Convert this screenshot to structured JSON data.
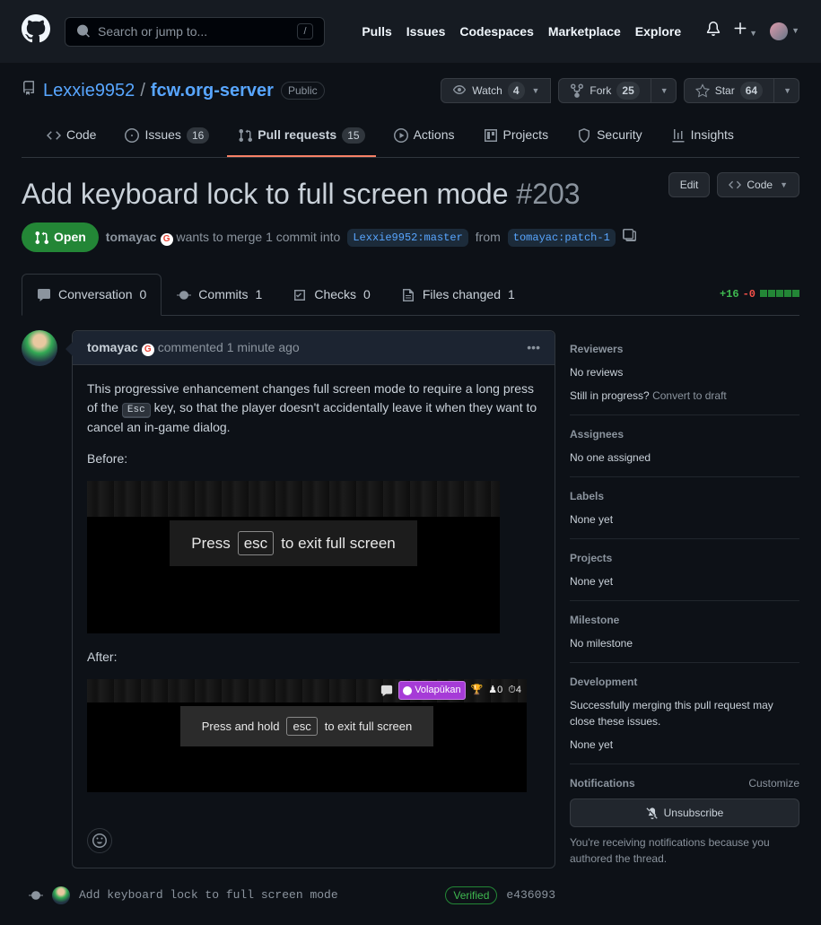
{
  "nav": {
    "search_placeholder": "Search or jump to...",
    "slash": "/",
    "pulls": "Pulls",
    "issues": "Issues",
    "codespaces": "Codespaces",
    "marketplace": "Marketplace",
    "explore": "Explore"
  },
  "repo": {
    "owner": "Lexxie9952",
    "name": "fcw.org-server",
    "sep": "/",
    "visibility": "Public",
    "watch": {
      "label": "Watch",
      "count": "4"
    },
    "fork": {
      "label": "Fork",
      "count": "25"
    },
    "star": {
      "label": "Star",
      "count": "64"
    },
    "tabs": {
      "code": "Code",
      "issues": {
        "label": "Issues",
        "count": "16"
      },
      "pulls": {
        "label": "Pull requests",
        "count": "15"
      },
      "actions": "Actions",
      "projects": "Projects",
      "security": "Security",
      "insights": "Insights"
    }
  },
  "pr": {
    "title": "Add keyboard lock to full screen mode",
    "number": "#203",
    "edit": "Edit",
    "code_btn": "Code",
    "state": "Open",
    "author": "tomayac",
    "merge_text_1": "wants to merge 1 commit into",
    "base": "Lexxie9952:master",
    "from": "from",
    "head": "tomayac:patch-1",
    "tabs": {
      "conversation": {
        "label": "Conversation",
        "count": "0"
      },
      "commits": {
        "label": "Commits",
        "count": "1"
      },
      "checks": {
        "label": "Checks",
        "count": "0"
      },
      "files": {
        "label": "Files changed",
        "count": "1"
      }
    },
    "diff": {
      "plus": "+16",
      "minus": "-0"
    }
  },
  "comment": {
    "author": "tomayac",
    "meta": "commented 1 minute ago",
    "para1_a": "This progressive enhancement changes full screen mode to require a long press of the ",
    "para1_key": "Esc",
    "para1_b": " key, so that the player doesn't accidentally leave it when they want to cancel an in-game dialog.",
    "before_label": "Before:",
    "before_banner_pre": "Press",
    "before_banner_key": "esc",
    "before_banner_post": "to exit full screen",
    "after_label": "After:",
    "after_banner_pre": "Press and hold",
    "after_banner_key": "esc",
    "after_banner_post": "to exit full screen",
    "after_volapukan": "Volapūkan",
    "after_count1": "0",
    "after_count2": "4"
  },
  "commit": {
    "message": "Add keyboard lock to full screen mode",
    "verified": "Verified",
    "sha": "e436093"
  },
  "side": {
    "reviewers": {
      "title": "Reviewers",
      "body": "No reviews",
      "draft_q": "Still in progress?",
      "draft_link": "Convert to draft"
    },
    "assignees": {
      "title": "Assignees",
      "body": "No one assigned"
    },
    "labels": {
      "title": "Labels",
      "body": "None yet"
    },
    "projects": {
      "title": "Projects",
      "body": "None yet"
    },
    "milestone": {
      "title": "Milestone",
      "body": "No milestone"
    },
    "development": {
      "title": "Development",
      "body": "Successfully merging this pull request may close these issues.",
      "none": "None yet"
    },
    "notifications": {
      "title": "Notifications",
      "customize": "Customize",
      "unsubscribe": "Unsubscribe",
      "you_receive": "You're receiving notifications because you authored the thread."
    }
  }
}
